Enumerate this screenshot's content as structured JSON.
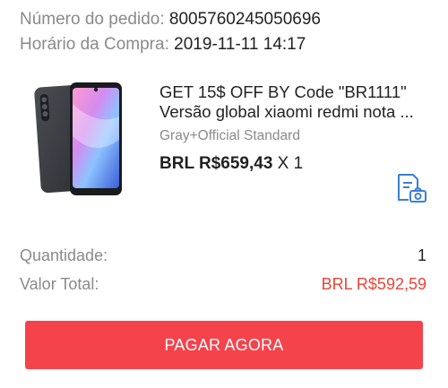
{
  "order": {
    "number_label": "Número do pedido:",
    "number_value": "8005760245050696",
    "time_label": "Horário da Compra:",
    "time_value": "2019-11-11 14:17"
  },
  "product": {
    "title_line1": "GET 15$ OFF BY Code \"BR1111\"",
    "title_line2": "Versão global xiaomi redmi nota ...",
    "variant": "Gray+Official Standard",
    "price": "BRL R$659,43",
    "quantity_suffix": "X 1",
    "invoice_icon": "invoice-photo-icon"
  },
  "summary": {
    "quantity_label": "Quantidade:",
    "quantity_value": "1",
    "total_label": "Valor Total:",
    "total_value": "BRL R$592,59"
  },
  "actions": {
    "pay_label": "PAGAR AGORA"
  },
  "colors": {
    "accent": "#f4434b",
    "total": "#e8453a",
    "icon": "#3b7fd4"
  }
}
